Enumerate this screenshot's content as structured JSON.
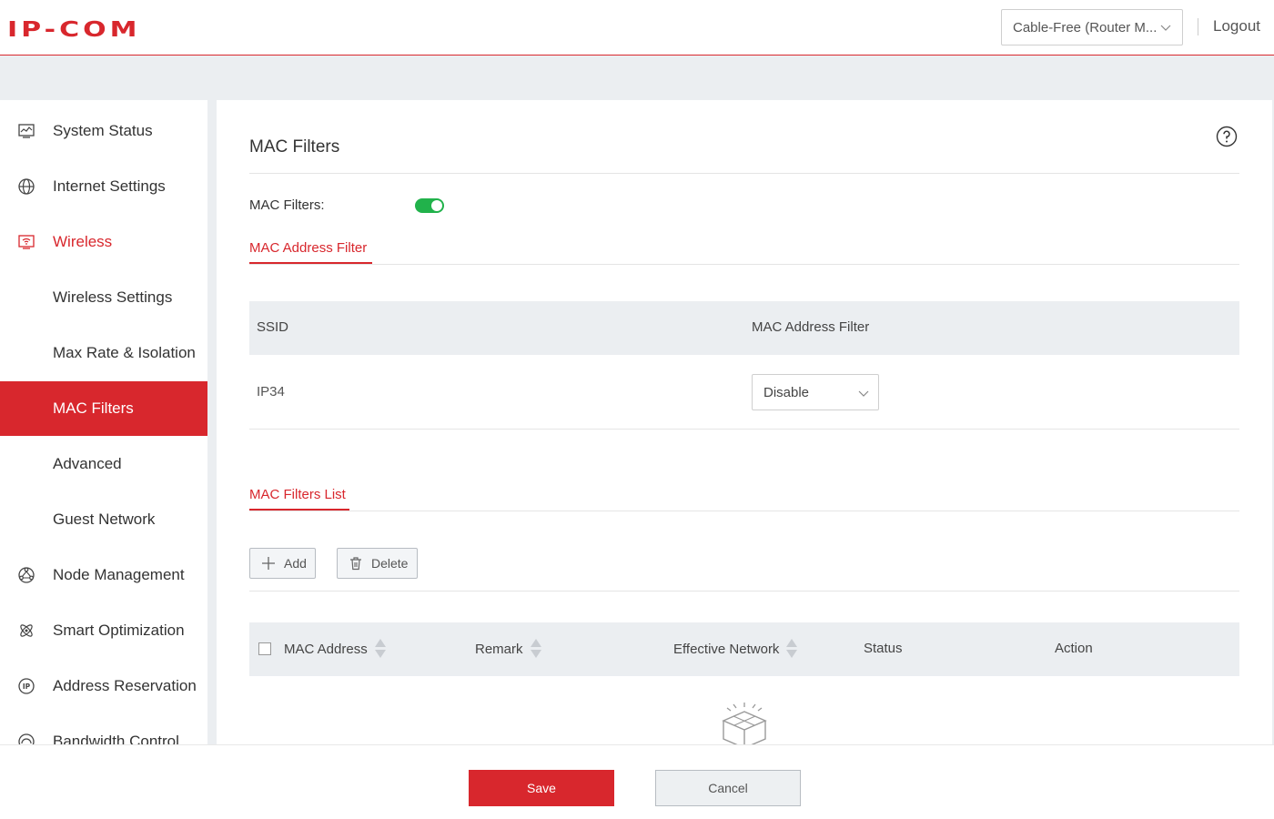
{
  "header": {
    "logo": "IP-COM",
    "device_selector": "Cable-Free (Router M...",
    "logout": "Logout"
  },
  "sidebar": {
    "items": [
      {
        "label": "System Status",
        "icon": "monitor-chart-icon"
      },
      {
        "label": "Internet Settings",
        "icon": "globe-icon"
      },
      {
        "label": "Wireless",
        "icon": "wifi-screen-icon"
      },
      {
        "label": "Wireless Settings"
      },
      {
        "label": "Max Rate & Isolation"
      },
      {
        "label": "MAC Filters"
      },
      {
        "label": "Advanced"
      },
      {
        "label": "Guest Network"
      },
      {
        "label": "Node Management",
        "icon": "node-network-icon"
      },
      {
        "label": "Smart Optimization",
        "icon": "atom-icon"
      },
      {
        "label": "Address Reservation",
        "icon": "ip-circle-icon"
      },
      {
        "label": "Bandwidth Control",
        "icon": "gauge-icon"
      }
    ]
  },
  "main": {
    "title": "MAC Filters",
    "mac_filters_label": "MAC Filters:",
    "mac_filters_enabled": true,
    "address_filter_tab": "MAC Address Filter",
    "ssid_table": {
      "columns": [
        "SSID",
        "MAC Address Filter"
      ],
      "rows": [
        {
          "ssid": "IP34",
          "filter": "Disable"
        }
      ]
    },
    "filters_list_tab": "MAC Filters List",
    "add_button": "Add",
    "delete_button": "Delete",
    "list_table": {
      "columns": [
        "MAC Address",
        "Remark",
        "Effective Network",
        "Status",
        "Action"
      ]
    }
  },
  "footer": {
    "save": "Save",
    "cancel": "Cancel"
  },
  "colors": {
    "accent": "#d8272d",
    "toggle_on": "#21b24b",
    "band": "#ebeef1"
  }
}
